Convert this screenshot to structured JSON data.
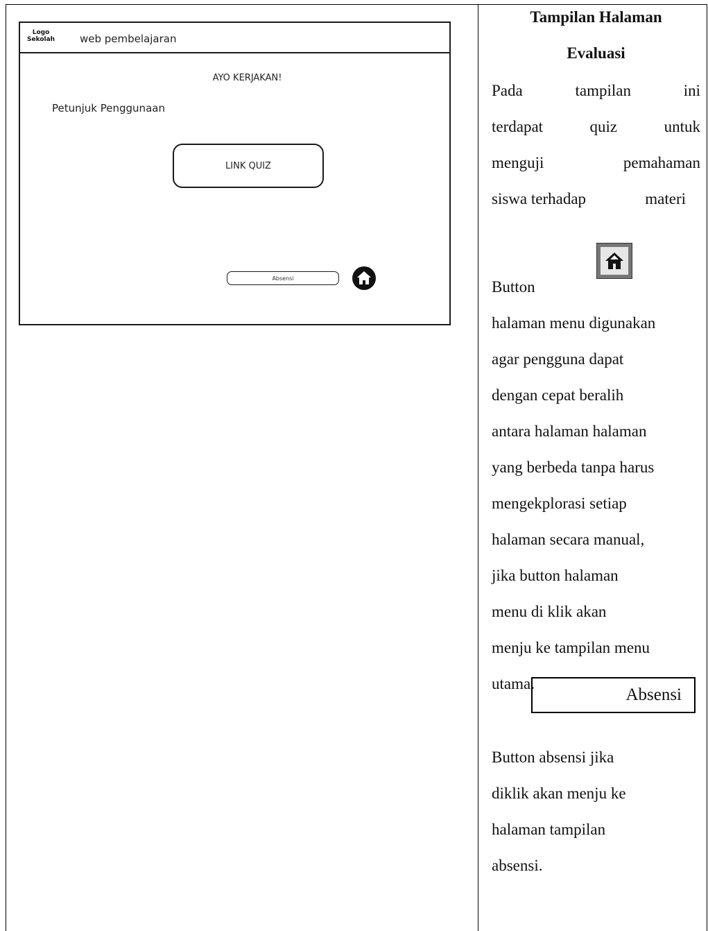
{
  "mockup": {
    "logo_line1": "Logo",
    "logo_line2": "Sekolah",
    "site_name": "web pembelajaran",
    "heading": "AYO KERJAKAN!",
    "guide_label": "Petunjuk Penggunaan",
    "quiz_button": "LINK QUIZ",
    "absensi_button": "Absensi",
    "home_icon": "home-icon"
  },
  "description": {
    "title_line1": "Tampilan Halaman",
    "title_line2": "Evaluasi",
    "intro_lines": [
      [
        "Pada",
        "tampilan",
        "ini"
      ],
      [
        "terdapat",
        "quiz",
        "untuk"
      ],
      [
        "menguji",
        "pemahaman"
      ],
      [
        "siswa terhadap",
        "materi"
      ]
    ],
    "button_label": "Button",
    "home_button_icon": "home-icon",
    "home_lines": [
      "halaman menu digunakan",
      "agar pengguna dapat",
      "dengan cepat beralih",
      "antara halaman halaman",
      "yang berbeda tanpa harus",
      "mengekplorasi setiap",
      "halaman secara manual,",
      "jika button  halaman",
      "menu  di  klik akan",
      "menju ke tampilan menu",
      "utama."
    ],
    "absensi_box": "Absensi",
    "absensi_lines": [
      "Button absensi jika",
      "diklik akan menju ke",
      "halaman tampilan",
      "absensi."
    ]
  }
}
